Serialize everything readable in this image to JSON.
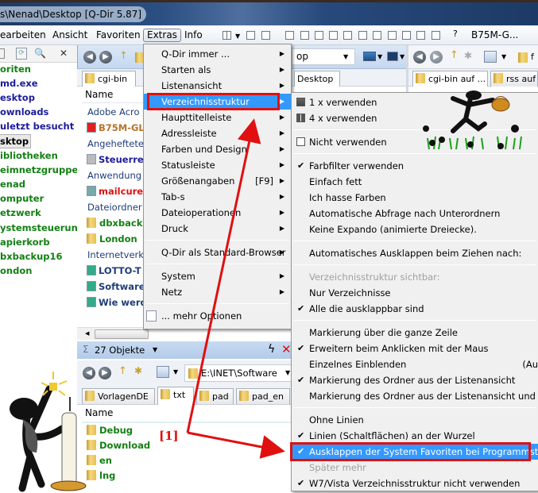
{
  "window": {
    "title": "s\\Nenad\\Desktop  [Q-Dir 5.87]"
  },
  "menubar": {
    "items": [
      "earbeiten",
      "Ansicht",
      "Favoriten",
      "Extras",
      "Info"
    ],
    "right_label": "B75M-G..."
  },
  "tree": {
    "items": [
      {
        "label": "oriten",
        "color": "green"
      },
      {
        "label": "md.exe",
        "color": "blue"
      },
      {
        "label": "esktop",
        "color": "blue"
      },
      {
        "label": "ownloads",
        "color": "blue"
      },
      {
        "label": "uletzt besucht",
        "color": "blue"
      },
      {
        "label": "sktop",
        "color": "black",
        "selected": true
      },
      {
        "label": "ibliotheken",
        "color": "green"
      },
      {
        "label": "eimnetzgruppe",
        "color": "green"
      },
      {
        "label": "enad",
        "color": "green"
      },
      {
        "label": "omputer",
        "color": "green"
      },
      {
        "label": "etzwerk",
        "color": "green"
      },
      {
        "label": "ystemsteuerung",
        "color": "green"
      },
      {
        "label": "apierkorb",
        "color": "green"
      },
      {
        "label": "bxbackup16",
        "color": "green"
      },
      {
        "label": "ondon",
        "color": "green"
      }
    ]
  },
  "pane1": {
    "tabs": [
      "cgi-bin"
    ],
    "header": "Name",
    "rows": [
      {
        "type": "group",
        "label": "Adobe Acro"
      },
      {
        "type": "item",
        "label": "B75M-GL",
        "color": "#b8722a",
        "icon": "pdf"
      },
      {
        "type": "group",
        "label": "Angeheftete"
      },
      {
        "type": "item",
        "label": "Steuerre",
        "color": "#1c1c9c",
        "icon": "shortcut"
      },
      {
        "type": "group",
        "label": "Anwendung"
      },
      {
        "type": "item",
        "label": "mailcure.",
        "color": "#e01010",
        "icon": "app"
      },
      {
        "type": "group",
        "label": "Dateiordner"
      },
      {
        "type": "item",
        "label": "dbxbacku",
        "color": "#138013",
        "icon": "folder"
      },
      {
        "type": "item",
        "label": "London",
        "color": "#138013",
        "icon": "folder"
      },
      {
        "type": "group",
        "label": "Internetverk"
      },
      {
        "type": "item",
        "label": "LOTTO-T",
        "color": "#1f3d7a",
        "icon": "web"
      },
      {
        "type": "item",
        "label": "Software",
        "color": "#1f3d7a",
        "icon": "web"
      },
      {
        "type": "item",
        "label": "Wie werd",
        "color": "#1f3d7a",
        "icon": "web"
      }
    ]
  },
  "pane2": {
    "address": "op",
    "tabs": [
      "Desktop"
    ]
  },
  "pane3": {
    "tabs": [
      "cgi-bin auf ...",
      "rss auf"
    ]
  },
  "statusbar": {
    "count": "27 Objekte"
  },
  "pane4": {
    "address": "E:\\INET\\Software",
    "tabs": [
      "VorlagenDE",
      "txt",
      "pad",
      "pad_en"
    ],
    "header": "Name",
    "rows": [
      "Debug",
      "Download",
      "en",
      "lng"
    ]
  },
  "extras_menu": {
    "items": [
      {
        "label": "Q-Dir immer ...",
        "submenu": true
      },
      {
        "label": "Starten als",
        "submenu": true
      },
      {
        "label": "Listenansicht",
        "submenu": true
      },
      {
        "label": "Verzeichnisstruktur",
        "submenu": true,
        "highlighted": true
      },
      {
        "label": "Haupttitelleiste",
        "submenu": true
      },
      {
        "label": "Adressleiste",
        "submenu": true
      },
      {
        "label": "Farben und Design",
        "submenu": true
      },
      {
        "label": "Statusleiste",
        "submenu": true
      },
      {
        "label": "Größenangaben",
        "shortcut": "[F9]",
        "submenu": true
      },
      {
        "label": "Tab-s",
        "submenu": true
      },
      {
        "label": "Dateioperationen",
        "submenu": true
      },
      {
        "label": "Druck",
        "submenu": true
      },
      {
        "sep": true
      },
      {
        "label": "Q-Dir als Standard-Browser",
        "submenu": true
      },
      {
        "sep": true
      },
      {
        "label": "System",
        "submenu": true
      },
      {
        "label": "Netz",
        "submenu": true
      },
      {
        "sep": true
      },
      {
        "label": "... mehr Optionen"
      }
    ]
  },
  "sub_menu": {
    "items": [
      {
        "label": "1 x verwenden",
        "icon": "grid"
      },
      {
        "label": "4 x verwenden",
        "icon": "grid4"
      },
      {
        "sep": true
      },
      {
        "label": "Nicht verwenden",
        "icon": "grid-empty"
      },
      {
        "sep": true
      },
      {
        "label": "Farbfilter verwenden",
        "checked": true
      },
      {
        "label": "Einfach fett"
      },
      {
        "label": "Ich hasse Farben"
      },
      {
        "label": "Automatische Abfrage nach Unterordnern"
      },
      {
        "label": "Keine Expando (animierte Dreiecke)."
      },
      {
        "sep": true
      },
      {
        "label": "Automatisches Ausklappen beim Ziehen nach:"
      },
      {
        "sep": true
      },
      {
        "label": "Verzeichnisstruktur sichtbar:",
        "disabled": true
      },
      {
        "label": "Nur Verzeichnisse"
      },
      {
        "label": "Alle die ausklappbar sind",
        "checked": true
      },
      {
        "sep": true
      },
      {
        "label": "Markierung über die ganze Zeile"
      },
      {
        "label": "Erweitern beim Anklicken mit der Maus",
        "checked": true
      },
      {
        "label": "Einzelnes Einblenden",
        "suffix": "(Au"
      },
      {
        "label": "Markierung des Ordner aus der Listenansicht",
        "checked": true
      },
      {
        "label": "Markierung des Ordner aus der Listenansicht und Aus"
      },
      {
        "sep": true
      },
      {
        "label": "Ohne Linien"
      },
      {
        "label": "Linien (Schaltflächen) an der Wurzel",
        "checked": true
      },
      {
        "label": "Ausklappen der System Favoriten bei Programmstart",
        "checked": true,
        "highlighted": true
      },
      {
        "label": "Später mehr",
        "disabled": true
      },
      {
        "label": "W7/Vista Verzeichnisstruktur nicht verwenden",
        "checked": true
      }
    ]
  },
  "annotation": {
    "label": "[1]",
    "color": "#e01010"
  },
  "colors": {
    "highlight": "#3399ff",
    "annotation_red": "#e01010"
  }
}
